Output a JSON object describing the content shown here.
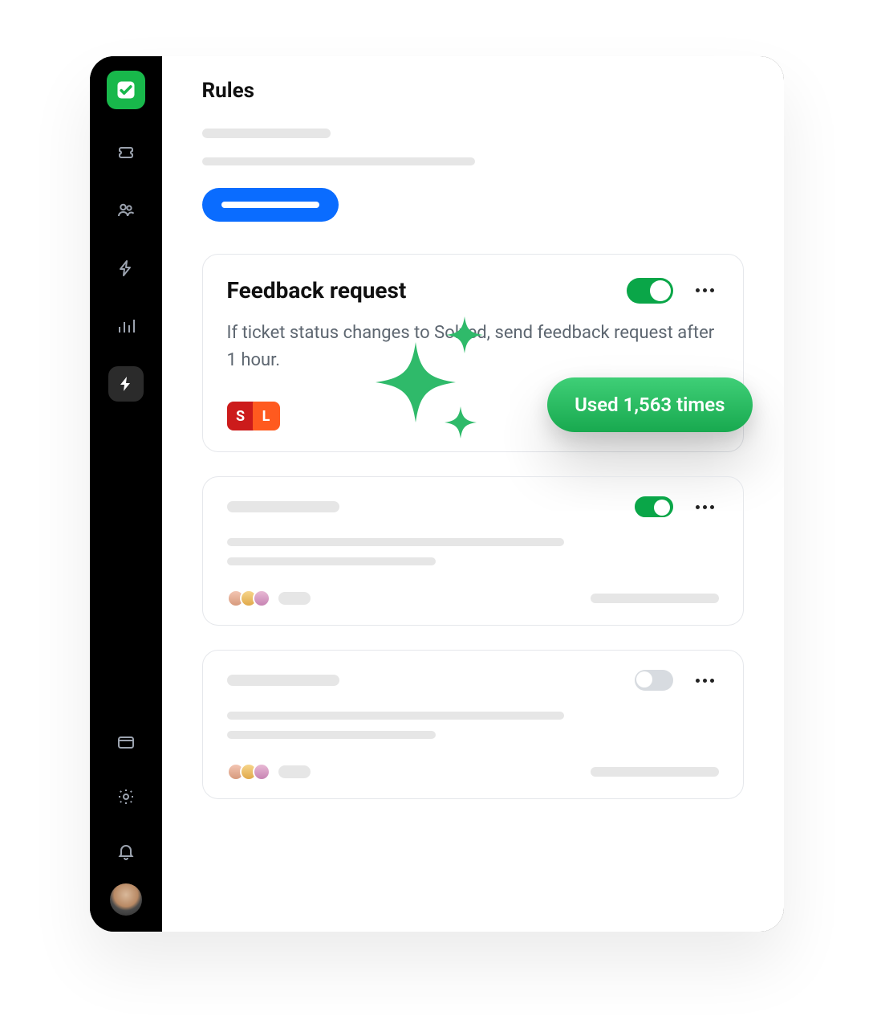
{
  "page": {
    "title": "Rules"
  },
  "rules": [
    {
      "title": "Feedback request",
      "description": "If ticket status changes to Solved, send feedback request after 1 hour.",
      "enabled": true,
      "usage_label": "Used 1,563 times",
      "badges": [
        "S",
        "L"
      ]
    },
    {
      "title": "",
      "description": "",
      "enabled": true,
      "placeholder": true
    },
    {
      "title": "",
      "description": "",
      "enabled": false,
      "placeholder": true
    }
  ],
  "sidebar": {
    "items": [
      "tickets",
      "contacts",
      "automation-outline",
      "analytics",
      "automation"
    ],
    "bottom": [
      "billing",
      "settings",
      "notifications"
    ],
    "active": "automation"
  },
  "colors": {
    "brand_green": "#18b84b",
    "toggle_green": "#0aa648",
    "primary_blue": "#0a6cff",
    "badge_red": "#cc1b1b",
    "badge_orange": "#ff5a1f"
  }
}
